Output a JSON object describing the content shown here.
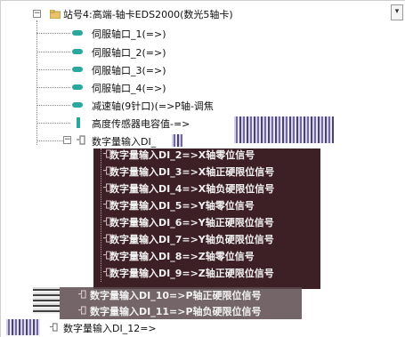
{
  "tree": {
    "root": {
      "label": "站号4:高端-轴卡EDS2000(数光5轴卡)",
      "expander": "−"
    },
    "children": [
      {
        "label": "伺服轴口_1(=>)",
        "icon": "servo-axis-icon"
      },
      {
        "label": "伺服轴口_2(=>)",
        "icon": "servo-axis-icon"
      },
      {
        "label": "伺服轴口_3(=>)",
        "icon": "servo-axis-icon"
      },
      {
        "label": "伺服轴口_4(=>)",
        "icon": "servo-axis-icon"
      },
      {
        "label": "减速轴(9针口)(=>P轴-调焦",
        "icon": "servo-axis-icon"
      },
      {
        "label": "高度传感器电容值-=>",
        "icon": "sensor-icon"
      },
      {
        "label": "数字量输入DI_",
        "icon": "digital-input-icon",
        "expander": "−"
      }
    ],
    "di_children": [
      {
        "label": "数字量输入DI_2=>X轴零位信号"
      },
      {
        "label": "数字量输入DI_3=>X轴正硬限位信号"
      },
      {
        "label": "数字量输入DI_4=>X轴负硬限位信号"
      },
      {
        "label": "数字量输入DI_5=>Y轴零位信号"
      },
      {
        "label": "数字量输入DI_6=>Y轴正硬限位信号"
      },
      {
        "label": "数字量输入DI_7=>Y轴负硬限位信号"
      },
      {
        "label": "数字量输入DI_8=>Z轴零位信号"
      },
      {
        "label": "数字量输入DI_9=>Z轴正硬限位信号"
      }
    ],
    "lower": [
      {
        "label": "数字量输入DI_10=>P轴正硬限位信号"
      },
      {
        "label": "数字量输入DI_11=>P轴负硬限位信号"
      },
      {
        "label": "数字量输入DI_12=>"
      }
    ]
  },
  "colors": {
    "dark_band": "#3d1f26",
    "servo_icon": "#2aa8a0"
  }
}
